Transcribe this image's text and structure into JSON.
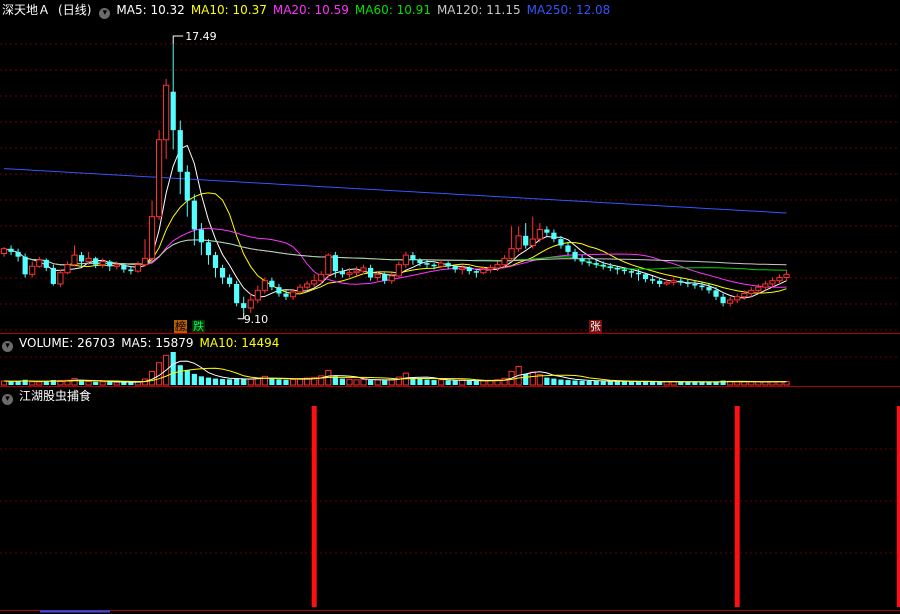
{
  "main_header": {
    "stock_title": "深天地Ａ",
    "period": "(日线)",
    "indicators": [
      {
        "label": "MA5: 10.32",
        "color": "#ffffff"
      },
      {
        "label": "MA10: 10.37",
        "color": "#ffff00"
      },
      {
        "label": "MA20: 10.59",
        "color": "#ff33ff"
      },
      {
        "label": "MA60: 10.91",
        "color": "#00e000"
      },
      {
        "label": "MA120: 11.15",
        "color": "#c8c8c8"
      },
      {
        "label": "MA250: 12.08",
        "color": "#3355ff"
      }
    ]
  },
  "volume_header": {
    "label": "VOLUME: 26703",
    "indicators": [
      {
        "label": "MA5: 15879",
        "color": "#ffffff"
      },
      {
        "label": "MA10: 14494",
        "color": "#ffff00"
      }
    ]
  },
  "indicator_header": {
    "label": "江湖股虫捕食"
  },
  "markers": [
    {
      "text": "榜",
      "bg": "#b45f00",
      "color": "#000000"
    },
    {
      "text": "跌",
      "bg": "#003300",
      "color": "#00ff66"
    },
    {
      "text": "张",
      "bg": "#7a1010",
      "color": "#ffffff"
    }
  ],
  "chart_data": {
    "type": "candlestick",
    "price_annotations": {
      "high": "17.49",
      "low": "9.10"
    },
    "price_range": [
      8.5,
      18.3
    ],
    "candles": [
      [
        10.95,
        11.1,
        10.85,
        11.15
      ],
      [
        11.1,
        11.0,
        10.9,
        11.2
      ],
      [
        11.0,
        10.85,
        10.7,
        11.1
      ],
      [
        10.85,
        10.3,
        10.2,
        10.95
      ],
      [
        10.3,
        10.55,
        10.2,
        10.7
      ],
      [
        10.55,
        10.75,
        10.5,
        10.85
      ],
      [
        10.75,
        10.5,
        10.4,
        10.8
      ],
      [
        10.5,
        10.0,
        9.95,
        10.6
      ],
      [
        10.0,
        10.35,
        9.9,
        10.45
      ],
      [
        10.35,
        10.6,
        10.3,
        10.7
      ],
      [
        10.6,
        10.9,
        10.55,
        11.2
      ],
      [
        10.9,
        10.7,
        10.55,
        11.0
      ],
      [
        10.7,
        10.8,
        10.6,
        11.0
      ],
      [
        10.8,
        10.6,
        10.5,
        10.85
      ],
      [
        10.6,
        10.7,
        10.5,
        10.8
      ],
      [
        10.7,
        10.55,
        10.4,
        10.75
      ],
      [
        10.55,
        10.6,
        10.45,
        10.7
      ],
      [
        10.6,
        10.45,
        10.35,
        10.65
      ],
      [
        10.45,
        10.4,
        10.3,
        10.55
      ],
      [
        10.4,
        10.6,
        10.35,
        10.7
      ],
      [
        10.6,
        10.8,
        10.55,
        11.4
      ],
      [
        10.8,
        12.1,
        10.75,
        12.6
      ],
      [
        12.1,
        14.5,
        12.0,
        14.8
      ],
      [
        14.5,
        16.2,
        13.9,
        16.4
      ],
      [
        16.0,
        14.8,
        14.2,
        17.49
      ],
      [
        14.8,
        13.5,
        12.8,
        15.1
      ],
      [
        13.5,
        12.6,
        12.1,
        13.7
      ],
      [
        12.6,
        11.7,
        11.2,
        12.8
      ],
      [
        11.7,
        11.3,
        10.9,
        11.9
      ],
      [
        11.3,
        10.9,
        10.6,
        11.4
      ],
      [
        10.9,
        10.5,
        10.2,
        11.0
      ],
      [
        10.5,
        10.2,
        10.0,
        10.6
      ],
      [
        10.2,
        10.0,
        9.9,
        10.3
      ],
      [
        10.0,
        9.4,
        9.3,
        10.1
      ],
      [
        9.4,
        9.25,
        9.1,
        9.6
      ],
      [
        9.25,
        9.5,
        9.1,
        9.7
      ],
      [
        9.5,
        9.8,
        9.4,
        9.95
      ],
      [
        9.8,
        10.1,
        9.7,
        10.2
      ],
      [
        10.1,
        9.9,
        9.8,
        10.2
      ],
      [
        9.9,
        9.7,
        9.6,
        10.0
      ],
      [
        9.7,
        9.6,
        9.5,
        9.8
      ],
      [
        9.6,
        9.75,
        9.5,
        9.85
      ],
      [
        9.75,
        9.9,
        9.7,
        10.0
      ],
      [
        9.9,
        10.0,
        9.8,
        10.1
      ],
      [
        10.0,
        10.1,
        9.9,
        10.3
      ],
      [
        10.1,
        10.3,
        10.0,
        10.4
      ],
      [
        10.3,
        10.9,
        10.2,
        10.95
      ],
      [
        10.9,
        10.4,
        10.2,
        11.0
      ],
      [
        10.4,
        10.3,
        10.2,
        10.5
      ],
      [
        10.3,
        10.35,
        10.2,
        10.5
      ],
      [
        10.35,
        10.4,
        10.25,
        10.55
      ],
      [
        10.4,
        10.5,
        10.3,
        10.6
      ],
      [
        10.5,
        10.2,
        10.1,
        10.6
      ],
      [
        10.2,
        10.3,
        10.1,
        10.4
      ],
      [
        10.3,
        10.1,
        10.0,
        10.35
      ],
      [
        10.1,
        10.25,
        10.0,
        10.35
      ],
      [
        10.25,
        10.6,
        10.2,
        10.7
      ],
      [
        10.6,
        10.9,
        10.5,
        11.0
      ],
      [
        10.9,
        10.75,
        10.6,
        11.0
      ],
      [
        10.75,
        10.65,
        10.55,
        10.8
      ],
      [
        10.65,
        10.6,
        10.5,
        10.75
      ],
      [
        10.6,
        10.55,
        10.45,
        10.65
      ],
      [
        10.55,
        10.65,
        10.5,
        10.75
      ],
      [
        10.65,
        10.55,
        10.45,
        10.7
      ],
      [
        10.55,
        10.45,
        10.35,
        10.6
      ],
      [
        10.45,
        10.5,
        10.3,
        10.6
      ],
      [
        10.5,
        10.4,
        10.3,
        10.55
      ],
      [
        10.4,
        10.35,
        10.2,
        10.45
      ],
      [
        10.35,
        10.45,
        10.3,
        10.55
      ],
      [
        10.45,
        10.5,
        10.35,
        10.6
      ],
      [
        10.5,
        10.6,
        10.4,
        10.7
      ],
      [
        10.6,
        10.8,
        10.5,
        10.9
      ],
      [
        10.8,
        11.1,
        10.7,
        11.8
      ],
      [
        11.1,
        11.5,
        11.0,
        11.8
      ],
      [
        11.5,
        11.2,
        11.1,
        11.9
      ],
      [
        11.2,
        11.4,
        11.1,
        12.1
      ],
      [
        11.4,
        11.7,
        11.3,
        11.9
      ],
      [
        11.7,
        11.6,
        11.5,
        11.8
      ],
      [
        11.6,
        11.4,
        11.3,
        11.7
      ],
      [
        11.4,
        11.2,
        11.1,
        11.5
      ],
      [
        11.2,
        11.0,
        10.9,
        11.3
      ],
      [
        11.0,
        10.8,
        10.7,
        11.1
      ],
      [
        10.8,
        10.7,
        10.6,
        10.9
      ],
      [
        10.7,
        10.65,
        10.55,
        10.8
      ],
      [
        10.65,
        10.6,
        10.5,
        10.75
      ],
      [
        10.6,
        10.55,
        10.45,
        10.7
      ],
      [
        10.55,
        10.5,
        10.4,
        10.65
      ],
      [
        10.5,
        10.45,
        10.3,
        10.55
      ],
      [
        10.45,
        10.4,
        10.3,
        10.5
      ],
      [
        10.4,
        10.35,
        10.2,
        10.45
      ],
      [
        10.35,
        10.3,
        10.1,
        10.45
      ],
      [
        10.3,
        10.15,
        10.05,
        10.35
      ],
      [
        10.15,
        10.1,
        10.0,
        10.25
      ],
      [
        10.1,
        10.0,
        9.9,
        10.2
      ],
      [
        10.0,
        10.05,
        9.95,
        10.15
      ],
      [
        10.05,
        10.1,
        9.95,
        10.2
      ],
      [
        10.1,
        10.05,
        9.95,
        10.2
      ],
      [
        10.05,
        10.0,
        9.9,
        10.15
      ],
      [
        10.0,
        9.95,
        9.85,
        10.1
      ],
      [
        9.95,
        9.9,
        9.8,
        10.05
      ],
      [
        9.9,
        9.8,
        9.7,
        10.0
      ],
      [
        9.8,
        9.6,
        9.5,
        9.9
      ],
      [
        9.6,
        9.4,
        9.3,
        9.7
      ],
      [
        9.4,
        9.5,
        9.3,
        9.6
      ],
      [
        9.5,
        9.6,
        9.4,
        9.7
      ],
      [
        9.6,
        9.7,
        9.5,
        9.8
      ],
      [
        9.7,
        9.8,
        9.6,
        9.9
      ],
      [
        9.8,
        9.9,
        9.7,
        10.0
      ],
      [
        9.9,
        10.0,
        9.8,
        10.1
      ],
      [
        10.0,
        10.1,
        9.9,
        10.2
      ],
      [
        10.1,
        10.2,
        10.0,
        10.3
      ],
      [
        10.2,
        10.3,
        10.1,
        10.45
      ]
    ],
    "volumes": [
      3200,
      2800,
      3000,
      4200,
      2600,
      2400,
      2800,
      4000,
      3600,
      3800,
      5200,
      3200,
      2800,
      2600,
      2600,
      2400,
      2300,
      2400,
      2200,
      2600,
      4800,
      11000,
      18000,
      24000,
      26703,
      16000,
      12000,
      9000,
      7000,
      6000,
      5200,
      4800,
      4600,
      5200,
      5000,
      4800,
      5600,
      7000,
      5400,
      4600,
      4200,
      4400,
      5200,
      5600,
      6200,
      7400,
      11800,
      7000,
      5200,
      4600,
      4200,
      4400,
      4000,
      4200,
      3800,
      4200,
      6400,
      9600,
      6400,
      5000,
      4400,
      4000,
      4200,
      3800,
      3600,
      3800,
      3400,
      3200,
      3400,
      3600,
      4200,
      5400,
      11000,
      15000,
      9000,
      10400,
      8400,
      6000,
      5200,
      4400,
      4000,
      3600,
      3400,
      3200,
      3200,
      3000,
      2800,
      3000,
      2800,
      2800,
      2600,
      3000,
      2600,
      2500,
      2600,
      2700,
      2600,
      2500,
      2400,
      2300,
      2400,
      2800,
      3600,
      3000,
      2600,
      2500,
      2600,
      2700,
      2600,
      2500,
      2600,
      2800
    ],
    "signal_days": [
      44,
      104,
      127
    ]
  }
}
